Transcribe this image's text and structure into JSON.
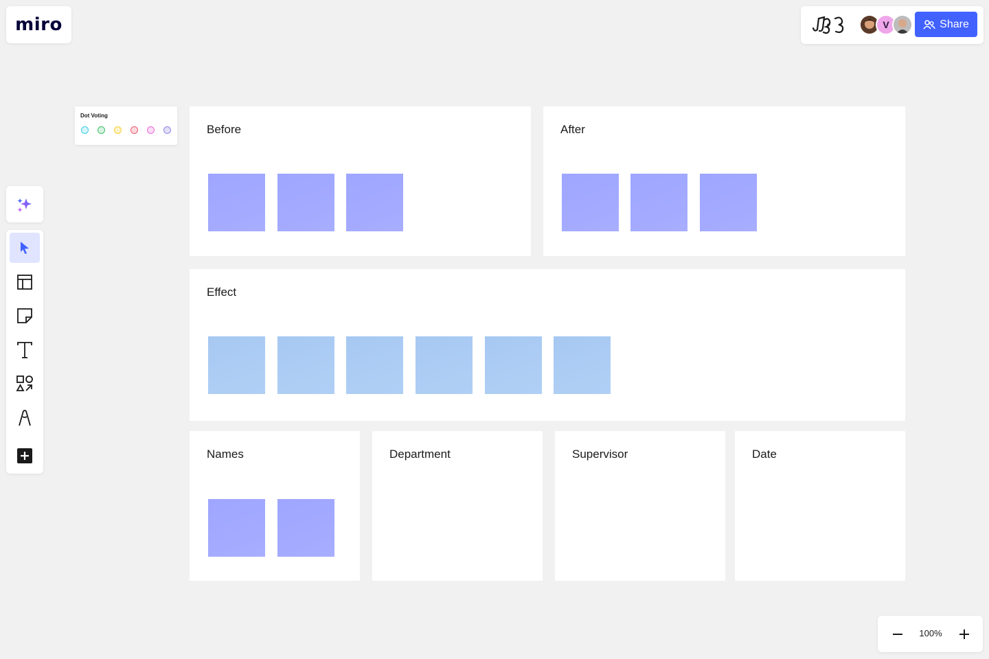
{
  "app": {
    "logo_text": "miro"
  },
  "header": {
    "avatars": [
      {
        "name": "user-avatar-photo-1",
        "initial": ""
      },
      {
        "name": "user-avatar-v",
        "initial": "V"
      },
      {
        "name": "user-avatar-photo-2",
        "initial": ""
      }
    ],
    "share_label": "Share",
    "accent": "#4262ff"
  },
  "dot_voting": {
    "title": "Dot Voting",
    "dot_colors": [
      "#3ad0e6",
      "#3cc06a",
      "#f4d23a",
      "#ee5a6e",
      "#e86ad8",
      "#8e86e8"
    ]
  },
  "frames": {
    "before": {
      "title": "Before",
      "sticky_count": 3,
      "sticky_color": "#a0a8ff"
    },
    "after": {
      "title": "After",
      "sticky_count": 3,
      "sticky_color": "#a0a8ff"
    },
    "effect": {
      "title": "Effect",
      "sticky_count": 6,
      "sticky_color": "#a8cbf3"
    },
    "names": {
      "title": "Names",
      "sticky_count": 2,
      "sticky_color": "#a0a8ff"
    },
    "department": {
      "title": "Department",
      "sticky_count": 0
    },
    "supervisor": {
      "title": "Supervisor",
      "sticky_count": 0
    },
    "date": {
      "title": "Date",
      "sticky_count": 0
    }
  },
  "toolbar": {
    "tools": [
      "ai-assist-icon",
      "select-tool-icon",
      "templates-icon",
      "sticky-note-icon",
      "text-tool-icon",
      "shapes-icon",
      "pen-icon",
      "more-apps-icon"
    ],
    "active": "select-tool-icon"
  },
  "zoom": {
    "level": "100%"
  }
}
